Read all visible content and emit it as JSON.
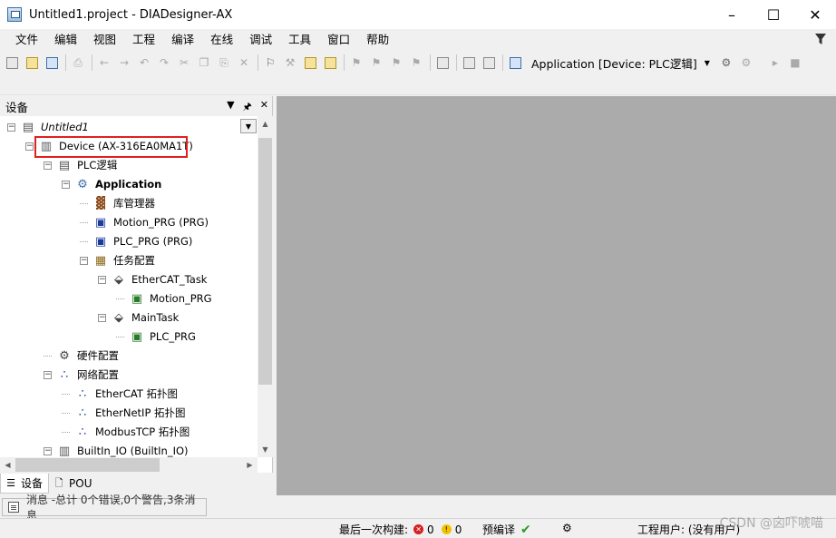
{
  "window": {
    "title": "Untitled1.project - DIADesigner-AX",
    "controls": [
      "minimize",
      "maximize",
      "close"
    ]
  },
  "menu": {
    "items": [
      "文件",
      "编辑",
      "视图",
      "工程",
      "编译",
      "在线",
      "调试",
      "工具",
      "窗口",
      "帮助"
    ]
  },
  "toolbar": {
    "active_application": "Application [Device: PLC逻辑]"
  },
  "devices_panel": {
    "title": "设备",
    "tree": [
      {
        "label": "Untitled1",
        "icon": "project-icon",
        "style": "italic"
      },
      {
        "label": "Device (AX-316EA0MA1T)",
        "icon": "device-icon",
        "style": "normal",
        "highlighted": true
      },
      {
        "label": "PLC逻辑",
        "icon": "plc-logic-icon",
        "style": "normal"
      },
      {
        "label": "Application",
        "icon": "application-gear-icon",
        "style": "bold"
      },
      {
        "label": "库管理器",
        "icon": "library-manager-icon",
        "style": "normal"
      },
      {
        "label": "Motion_PRG (PRG)",
        "icon": "pou-program-icon",
        "style": "normal"
      },
      {
        "label": "PLC_PRG (PRG)",
        "icon": "pou-program-icon",
        "style": "normal"
      },
      {
        "label": "任务配置",
        "icon": "task-config-icon",
        "style": "normal"
      },
      {
        "label": "EtherCAT_Task",
        "icon": "task-icon",
        "style": "normal"
      },
      {
        "label": "Motion_PRG",
        "icon": "program-call-icon",
        "style": "normal"
      },
      {
        "label": "MainTask",
        "icon": "task-icon",
        "style": "normal"
      },
      {
        "label": "PLC_PRG",
        "icon": "program-call-icon",
        "style": "normal"
      },
      {
        "label": "硬件配置",
        "icon": "hardware-config-icon",
        "style": "normal"
      },
      {
        "label": "网络配置",
        "icon": "network-config-icon",
        "style": "normal"
      },
      {
        "label": "EtherCAT 拓扑图",
        "icon": "topology-icon",
        "style": "normal"
      },
      {
        "label": "EtherNetIP 拓扑图",
        "icon": "topology-icon",
        "style": "normal"
      },
      {
        "label": "ModbusTCP 拓扑图",
        "icon": "topology-icon",
        "style": "normal"
      },
      {
        "label": "BuiltIn_IO (BuiltIn_IO)",
        "icon": "io-module-icon",
        "style": "normal"
      }
    ],
    "tabs": [
      {
        "label": "设备",
        "icon": "devices-tab-icon",
        "active": true
      },
      {
        "label": "POU",
        "icon": "pou-tab-icon",
        "active": false
      }
    ]
  },
  "messages": {
    "tab_label": "消息 -总计 0个错误,0个警告,3条消息"
  },
  "statusbar": {
    "last_build_label": "最后一次构建:",
    "errors": "0",
    "warnings": "0",
    "precompile_label": "预编译",
    "project_user": "工程用户: (没有用户)"
  },
  "watermark": "CSDN @囟吓唬喵"
}
